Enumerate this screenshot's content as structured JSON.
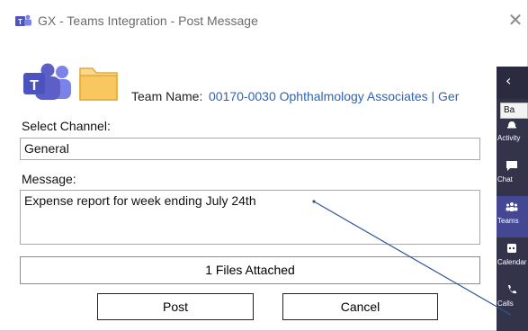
{
  "window": {
    "title": "GX - Teams Integration - Post Message"
  },
  "team": {
    "label": "Team Name:",
    "value": "00170-0030 Ophthalmology Associates | Ger"
  },
  "channel": {
    "label": "Select Channel:",
    "value": "General"
  },
  "message": {
    "label": "Message:",
    "value": "Expense report for week ending July 24th"
  },
  "attachments": {
    "text": "1 Files Attached"
  },
  "buttons": {
    "post": "Post",
    "cancel": "Cancel"
  },
  "teams_sidebar": {
    "back_icon": "chevron-left-icon",
    "badge": "Ba",
    "items": [
      {
        "label": "Activity",
        "icon": "bell-icon"
      },
      {
        "label": "Chat",
        "icon": "chat-icon"
      },
      {
        "label": "Teams",
        "icon": "teams-icon"
      },
      {
        "label": "Calendar",
        "icon": "calendar-icon"
      },
      {
        "label": "Calls",
        "icon": "phone-icon"
      }
    ]
  },
  "colors": {
    "link": "#2f63b6",
    "teams_purple": "#5b5fc7",
    "sidebar": "#33344a",
    "folder": "#f6c15b"
  }
}
